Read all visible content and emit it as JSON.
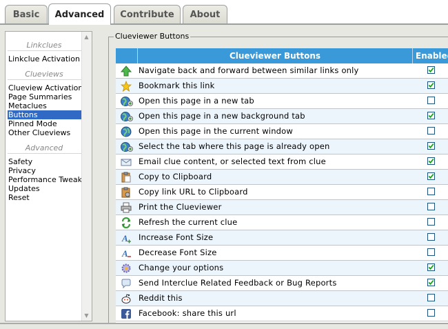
{
  "tabs": [
    {
      "label": "Basic",
      "active": false
    },
    {
      "label": "Advanced",
      "active": true
    },
    {
      "label": "Contribute",
      "active": false
    },
    {
      "label": "About",
      "active": false
    }
  ],
  "sidebar": {
    "groups": [
      {
        "heading": "Linkclues",
        "items": [
          "Linkclue Activation"
        ]
      },
      {
        "heading": "Clueviews",
        "items": [
          "Clueview Activation",
          "Page Summaries",
          "Metaclues",
          "Buttons",
          "Pinned Mode",
          "Other Clueviews"
        ]
      },
      {
        "heading": "Advanced",
        "items": [
          "Safety",
          "Privacy",
          "Performance Tweaks",
          "Updates",
          "Reset"
        ]
      }
    ],
    "selected": "Buttons"
  },
  "group_title": "Clueviewer Buttons",
  "table": {
    "headers": {
      "name": "Clueviewer Buttons",
      "enabled": "Enabled"
    },
    "rows": [
      {
        "icon": "green-up-arrow-icon",
        "label": "Navigate back and forward between similar links only",
        "enabled": true
      },
      {
        "icon": "star-icon",
        "label": "Bookmark this link",
        "enabled": true
      },
      {
        "icon": "globe-add-icon",
        "label": "Open this page in a new tab",
        "enabled": false
      },
      {
        "icon": "globe-add-icon",
        "label": "Open this page in a new background tab",
        "enabled": true
      },
      {
        "icon": "globe-icon",
        "label": "Open this page in the current window",
        "enabled": false
      },
      {
        "icon": "globe-add-icon",
        "label": "Select the tab where this page is already open",
        "enabled": true
      },
      {
        "icon": "envelope-icon",
        "label": "Email clue content, or selected text from clue",
        "enabled": true
      },
      {
        "icon": "clipboard-icon",
        "label": "Copy to Clipboard",
        "enabled": true
      },
      {
        "icon": "clipboard-link-icon",
        "label": "Copy link URL to Clipboard",
        "enabled": false
      },
      {
        "icon": "printer-icon",
        "label": "Print the Clueviewer",
        "enabled": false
      },
      {
        "icon": "refresh-icon",
        "label": "Refresh the current clue",
        "enabled": false
      },
      {
        "icon": "font-increase-icon",
        "label": "Increase Font Size",
        "enabled": false
      },
      {
        "icon": "font-decrease-icon",
        "label": "Decrease Font Size",
        "enabled": false
      },
      {
        "icon": "gear-icon",
        "label": "Change your options",
        "enabled": true
      },
      {
        "icon": "speech-bubble-icon",
        "label": "Send Interclue Related Feedback or Bug Reports",
        "enabled": true
      },
      {
        "icon": "reddit-icon",
        "label": "Reddit this",
        "enabled": false
      },
      {
        "icon": "facebook-icon",
        "label": "Facebook: share this url",
        "enabled": false
      }
    ]
  },
  "colors": {
    "header_blue": "#3a9ad9",
    "selection_blue": "#316ac5",
    "row_border": "#a8cbe6"
  }
}
